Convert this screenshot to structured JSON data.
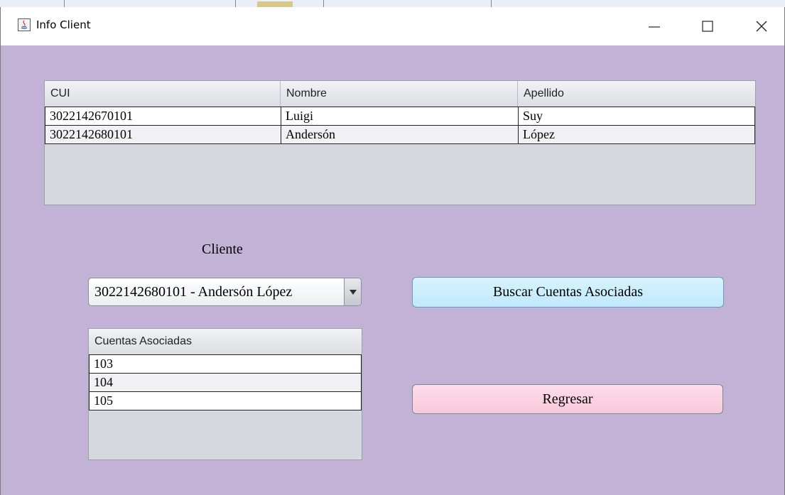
{
  "window": {
    "title": "Info Client"
  },
  "clients_table": {
    "headers": [
      "CUI",
      "Nombre",
      "Apellido"
    ],
    "rows": [
      [
        "3022142670101",
        "Luigi",
        "Suy"
      ],
      [
        "3022142680101",
        "Andersón",
        "López"
      ]
    ]
  },
  "client_select": {
    "label": "Cliente",
    "value": "3022142680101 - Andersón López"
  },
  "buttons": {
    "search_accounts": "Buscar Cuentas Asociadas",
    "back": "Regresar"
  },
  "accounts_table": {
    "header": "Cuentas Asociadas",
    "rows": [
      "103",
      "104",
      "105"
    ]
  },
  "colors": {
    "background": "#c2b2d6",
    "search_button": "#bfe9fb",
    "back_button": "#f8c9dc"
  }
}
